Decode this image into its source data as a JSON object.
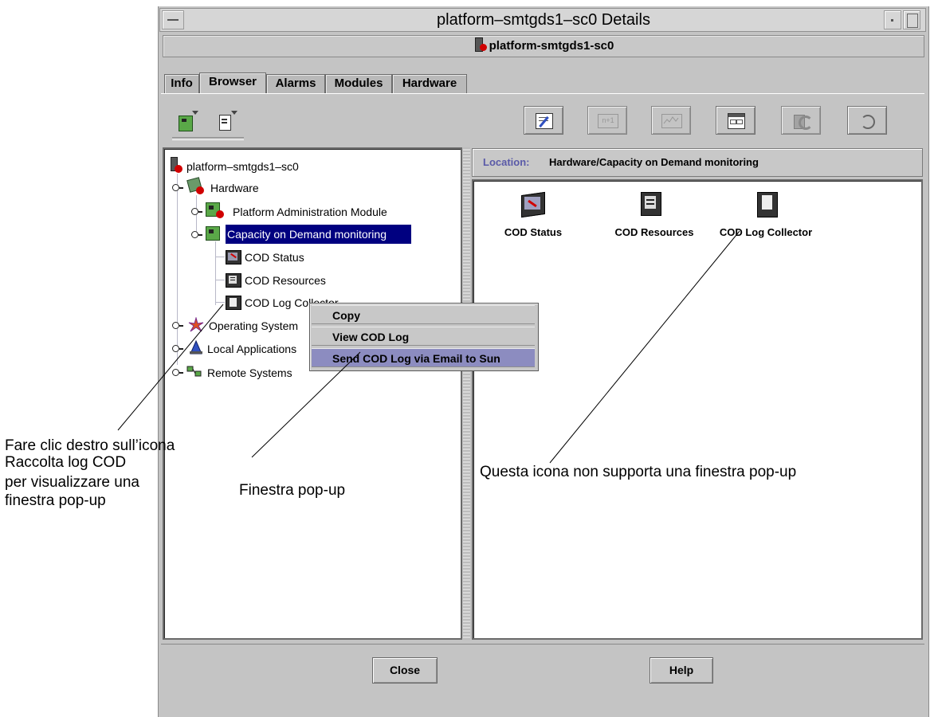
{
  "window": {
    "title": "platform–smtgds1–sc0 Details",
    "subtitle": "platform-smtgds1-sc0"
  },
  "tabs": [
    {
      "label": "Info"
    },
    {
      "label": "Browser"
    },
    {
      "label": "Alarms"
    },
    {
      "label": "Modules"
    },
    {
      "label": "Hardware"
    }
  ],
  "active_tab": "Browser",
  "toolbar_icons": [
    "properties-icon",
    "n-plus-1-icon",
    "graph-icon",
    "table-icon",
    "refresh-icon",
    "reload-icon"
  ],
  "tree": {
    "root": "platform–smtgds1–sc0",
    "hardware": "Hardware",
    "pam": "Platform Administration Module",
    "cod": "Capacity on Demand monitoring",
    "cod_status": "COD Status",
    "cod_resources": "COD Resources",
    "cod_log": "COD Log Collector",
    "os": "Operating System",
    "local_apps": "Local Applications",
    "remote": "Remote Systems"
  },
  "context_menu": {
    "copy": "Copy",
    "view": "View COD Log",
    "send": "Send COD Log via Email to Sun"
  },
  "location": {
    "label": "Location:",
    "value": "Hardware/Capacity on Demand monitoring"
  },
  "content_icons": [
    {
      "label": "COD Status"
    },
    {
      "label": "COD Resources"
    },
    {
      "label": "COD Log Collector"
    }
  ],
  "buttons": {
    "close": "Close",
    "help": "Help"
  },
  "annotations": {
    "left_1": "Fare clic destro sull’icona",
    "left_2": "Raccolta log COD",
    "left_3": "per visualizzare una",
    "left_4": "finestra pop-up",
    "middle": "Finestra pop-up",
    "right": "Questa icona non supporta una finestra pop-up"
  },
  "colors": {
    "selection": "#000080",
    "menu_highlight": "#8c8cc0",
    "location_label": "#5a5aa8",
    "alert": "#d00000"
  }
}
